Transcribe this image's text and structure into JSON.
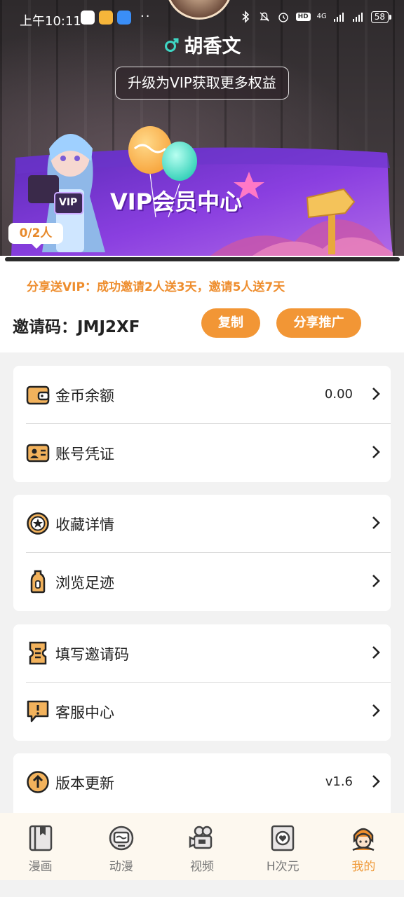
{
  "status_bar": {
    "time": "上午10:11",
    "dots": "··",
    "hd": "HD",
    "network": "4G",
    "battery": "58"
  },
  "profile": {
    "name": "胡香文",
    "vip_upgrade": "升级为VIP获取更多权益"
  },
  "vip_banner": {
    "title": "VIP会员中心",
    "badge": "VIP",
    "progress": "0/2人"
  },
  "invite": {
    "promo": "分享送VIP：成功邀请2人送3天，邀请5人送7天",
    "code_label": "邀请码：",
    "code": "JMJ2XF",
    "copy_button": "复制",
    "share_button": "分享推广"
  },
  "menu": {
    "coin_balance": {
      "label": "金币余额",
      "value": "0.00",
      "icon": "wallet-icon"
    },
    "account_credential": {
      "label": "账号凭证",
      "icon": "id-card-icon"
    },
    "favorites": {
      "label": "收藏详情",
      "icon": "star-badge-icon"
    },
    "history": {
      "label": "浏览足迹",
      "icon": "footprint-icon"
    },
    "enter_invite": {
      "label": "填写邀请码",
      "icon": "ticket-icon"
    },
    "support": {
      "label": "客服中心",
      "icon": "message-alert-icon"
    },
    "update": {
      "label": "版本更新",
      "value": "v1.6",
      "icon": "upload-arrow-icon"
    }
  },
  "nav": {
    "items": [
      {
        "label": "漫画",
        "icon": "book-icon"
      },
      {
        "label": "动漫",
        "icon": "tv-icon"
      },
      {
        "label": "视频",
        "icon": "camera-icon"
      },
      {
        "label": "H次元",
        "icon": "heart-frame-icon"
      },
      {
        "label": "我的",
        "icon": "profile-icon"
      }
    ],
    "active": "我的"
  },
  "colors": {
    "accent": "#f29635",
    "promo_text": "#ee8e2f",
    "nav_active": "#ef9a3a",
    "banner_purple": "#7b3fd6"
  }
}
